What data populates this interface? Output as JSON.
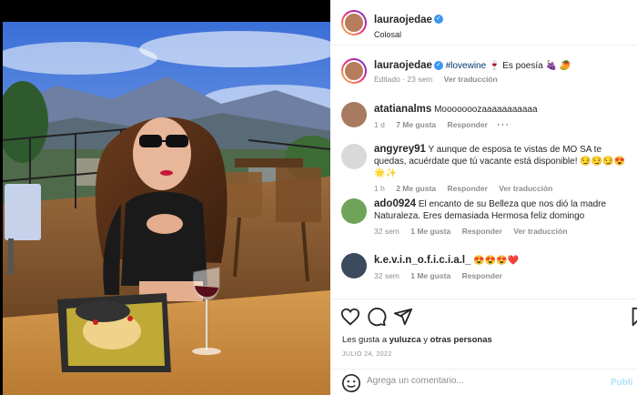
{
  "header": {
    "username": "lauraojedae",
    "location": "Colosal",
    "more_icon": "more-horizontal-icon"
  },
  "caption": {
    "username": "lauraojedae",
    "hashtag": "#lovewine",
    "text": "🍷 Es poesía 🍇 🥭",
    "edited": "Editado · 23 sem",
    "see_translation": "Ver traducción"
  },
  "comments": [
    {
      "username": "atatianalms",
      "text": "Mooooooozaaaaaaaaaaa",
      "time": "1 d",
      "likes": "7 Me gusta",
      "reply": "Responder",
      "translate": "",
      "options": "···"
    },
    {
      "username": "angyrey91",
      "text": "Y aunque de esposa te vistas de MO SA te quedas, acuérdate que tú vacante está disponible! 😏😏😏😍🌟✨",
      "time": "1 h",
      "likes": "2 Me gusta",
      "reply": "Responder",
      "translate": "Ver traducción"
    },
    {
      "username": "ado0924",
      "text": "El encanto de su Belleza que nos dió la madre Naturaleza. Eres demasiada Hermosa feliz domingo",
      "time": "32 sem",
      "likes": "1 Me gusta",
      "reply": "Responder",
      "translate": "Ver traducción"
    },
    {
      "username": "k.e.v.i.n_o.f.i.c.i.a.l_",
      "text": "😍😍😍❤️",
      "time": "32 sem",
      "likes": "1 Me gusta",
      "reply": "Responder",
      "translate": ""
    }
  ],
  "likes": {
    "prefix": "Les gusta a ",
    "user": "yuluzca",
    "middle": " y ",
    "others": "otras personas"
  },
  "date": "JULIO 24, 2022",
  "composer": {
    "placeholder": "Agrega un comentario...",
    "publish": "Publi"
  },
  "colors": {
    "accent": "#0095f6",
    "verified": "#3897f0",
    "muted": "#8e8e8e"
  }
}
